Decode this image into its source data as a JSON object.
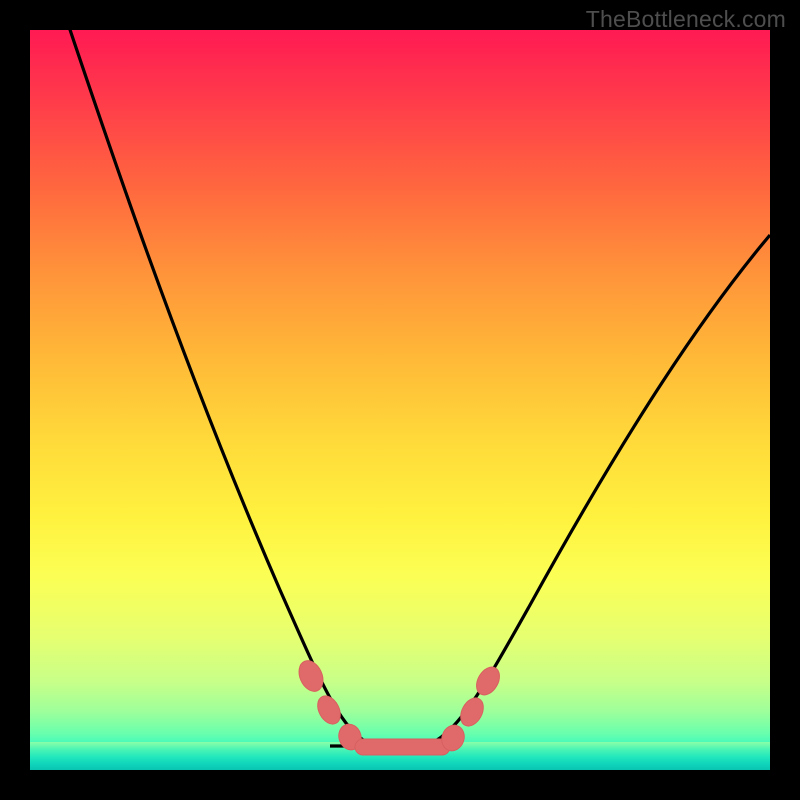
{
  "watermark": "TheBottleneck.com",
  "colors": {
    "frame": "#000000",
    "curve_stroke": "#000000",
    "marker_fill": "#e06a6a",
    "marker_stroke": "#c94f4f",
    "watermark_text": "#4e4e4e"
  },
  "chart_data": {
    "type": "line",
    "title": "",
    "xlabel": "",
    "ylabel": "",
    "xlim": [
      0,
      100
    ],
    "ylim": [
      0,
      100
    ],
    "grid": false,
    "note": "Values estimated from pixels; y=0 is bottom of plot, y=100 is top. Curve is a bottleneck V-shape with flat basin ~42–58 on x.",
    "series": [
      {
        "name": "bottleneck-curve",
        "x": [
          0,
          4,
          8,
          12,
          16,
          20,
          24,
          28,
          32,
          36,
          40,
          44,
          48,
          52,
          56,
          60,
          64,
          68,
          72,
          76,
          80,
          84,
          88,
          92,
          96,
          100
        ],
        "y": [
          108,
          99,
          90,
          81,
          72,
          63,
          54,
          45,
          36,
          27,
          16,
          6,
          3,
          3,
          6,
          12,
          18,
          24,
          30,
          36,
          42,
          48,
          54,
          60,
          66,
          72
        ]
      }
    ],
    "markers": {
      "name": "optimum-range",
      "shape": "rounded-blob",
      "points": [
        {
          "x": 38,
          "y": 13
        },
        {
          "x": 40,
          "y": 9
        },
        {
          "x": 44,
          "y": 4
        },
        {
          "x": 48,
          "y": 3
        },
        {
          "x": 52,
          "y": 3
        },
        {
          "x": 56,
          "y": 4
        },
        {
          "x": 59,
          "y": 8
        },
        {
          "x": 61,
          "y": 12
        }
      ]
    }
  }
}
